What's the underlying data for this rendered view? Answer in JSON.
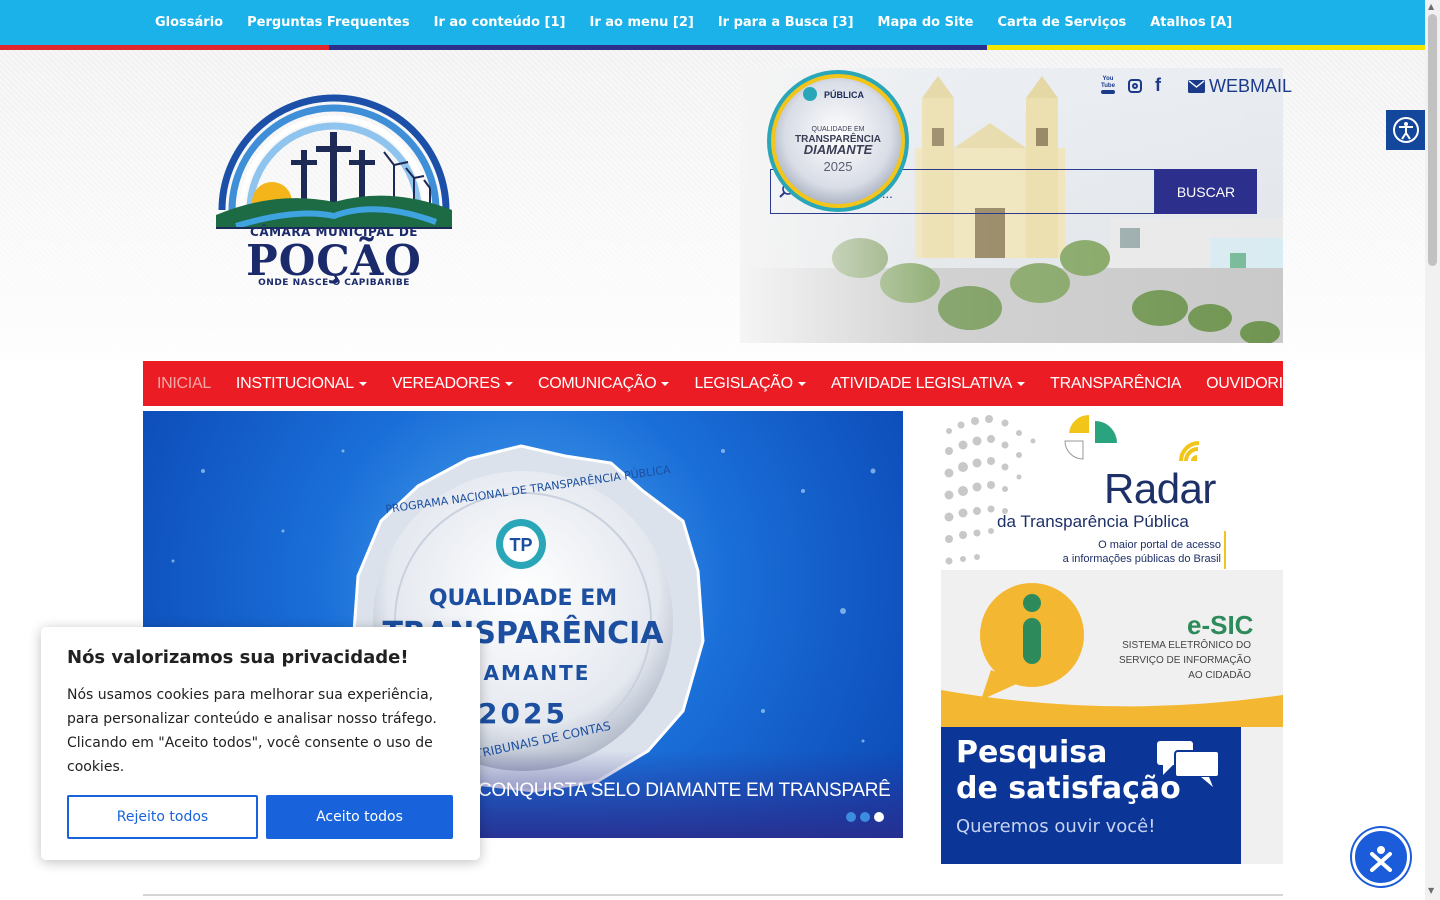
{
  "topbar": {
    "links": [
      {
        "label": "Glossário"
      },
      {
        "label": "Perguntas Frequentes"
      },
      {
        "label": "Ir ao conteúdo [1]"
      },
      {
        "label": "Ir ao menu [2]"
      },
      {
        "label": "Ir para a Busca [3]"
      },
      {
        "label": "Mapa do Site"
      },
      {
        "label": "Carta de Serviços"
      },
      {
        "label": "Atalhos [A]"
      }
    ],
    "colors": {
      "bar": "#1ab2e8",
      "stripe_red": "#e0262e",
      "stripe_navy": "#2c2f8c",
      "stripe_yellow": "#f2e600"
    }
  },
  "logo": {
    "line1": "CÂMARA MUNICIPAL DE",
    "line2": "POÇÃO",
    "line3": "ONDE NASCE O CAPIBARIBE"
  },
  "header": {
    "social_icons": [
      "youtube-icon",
      "instagram-icon",
      "facebook-icon"
    ],
    "youtube_text": "You Tube",
    "webmail_label": "WEBMAIL",
    "seal": {
      "brand": "PÚBLICA",
      "line1": "QUALIDADE EM",
      "line2": "TRANSPARÊNCIA",
      "line3": "DIAMANTE",
      "year": "2025"
    },
    "search": {
      "placeholder": "buscar no site...",
      "button": "BUSCAR"
    }
  },
  "nav": {
    "items": [
      {
        "label": "INICIAL",
        "dropdown": false,
        "active": true
      },
      {
        "label": "INSTITUCIONAL",
        "dropdown": true
      },
      {
        "label": "VEREADORES",
        "dropdown": true
      },
      {
        "label": "COMUNICAÇÃO",
        "dropdown": true
      },
      {
        "label": "LEGISLAÇÃO",
        "dropdown": true
      },
      {
        "label": "ATIVIDADE LEGISLATIVA",
        "dropdown": true
      },
      {
        "label": "TRANSPARÊNCIA",
        "dropdown": false
      },
      {
        "label": "OUVIDORIA",
        "dropdown": false
      }
    ],
    "color": "#ec1c24"
  },
  "slider": {
    "badge": {
      "ring_top": "PROGRAMA NACIONAL DE TRANSPARÊNCIA PÚBLICA",
      "ring_bottom": "TRIBUNAIS DE CONTAS",
      "line1": "QUALIDADE EM",
      "line2": "TRANSPARÊNCIA",
      "line3": "DIAMANTE",
      "year": "2025"
    },
    "caption": "CONQUISTA SELO DIAMANTE EM TRANSPARÊ",
    "dots": 3,
    "active_dot": 3
  },
  "banners": {
    "radar": {
      "title": "Radar",
      "subtitle": "da Transparência Pública",
      "tagline1": "O maior portal de acesso",
      "tagline2": "a informações públicas do Brasil"
    },
    "esic": {
      "title": "e-SIC",
      "line1": "SISTEMA ELETRÔNICO DO",
      "line2": "SERVIÇO DE INFORMAÇÃO",
      "line3": "AO CIDADÃO"
    },
    "pesquisa": {
      "line1": "Pesquisa",
      "line2": "de satisfação",
      "line3": "Queremos ouvir você!"
    }
  },
  "cookie": {
    "title": "Nós valorizamos sua privacidade!",
    "text": "Nós usamos cookies para melhorar sua experiência, para personalizar conteúdo e analisar nosso tráfego. Clicando em \"Aceito todos\", você consente o uso de cookies.",
    "reject": "Rejeito todos",
    "accept": "Aceito todos"
  }
}
